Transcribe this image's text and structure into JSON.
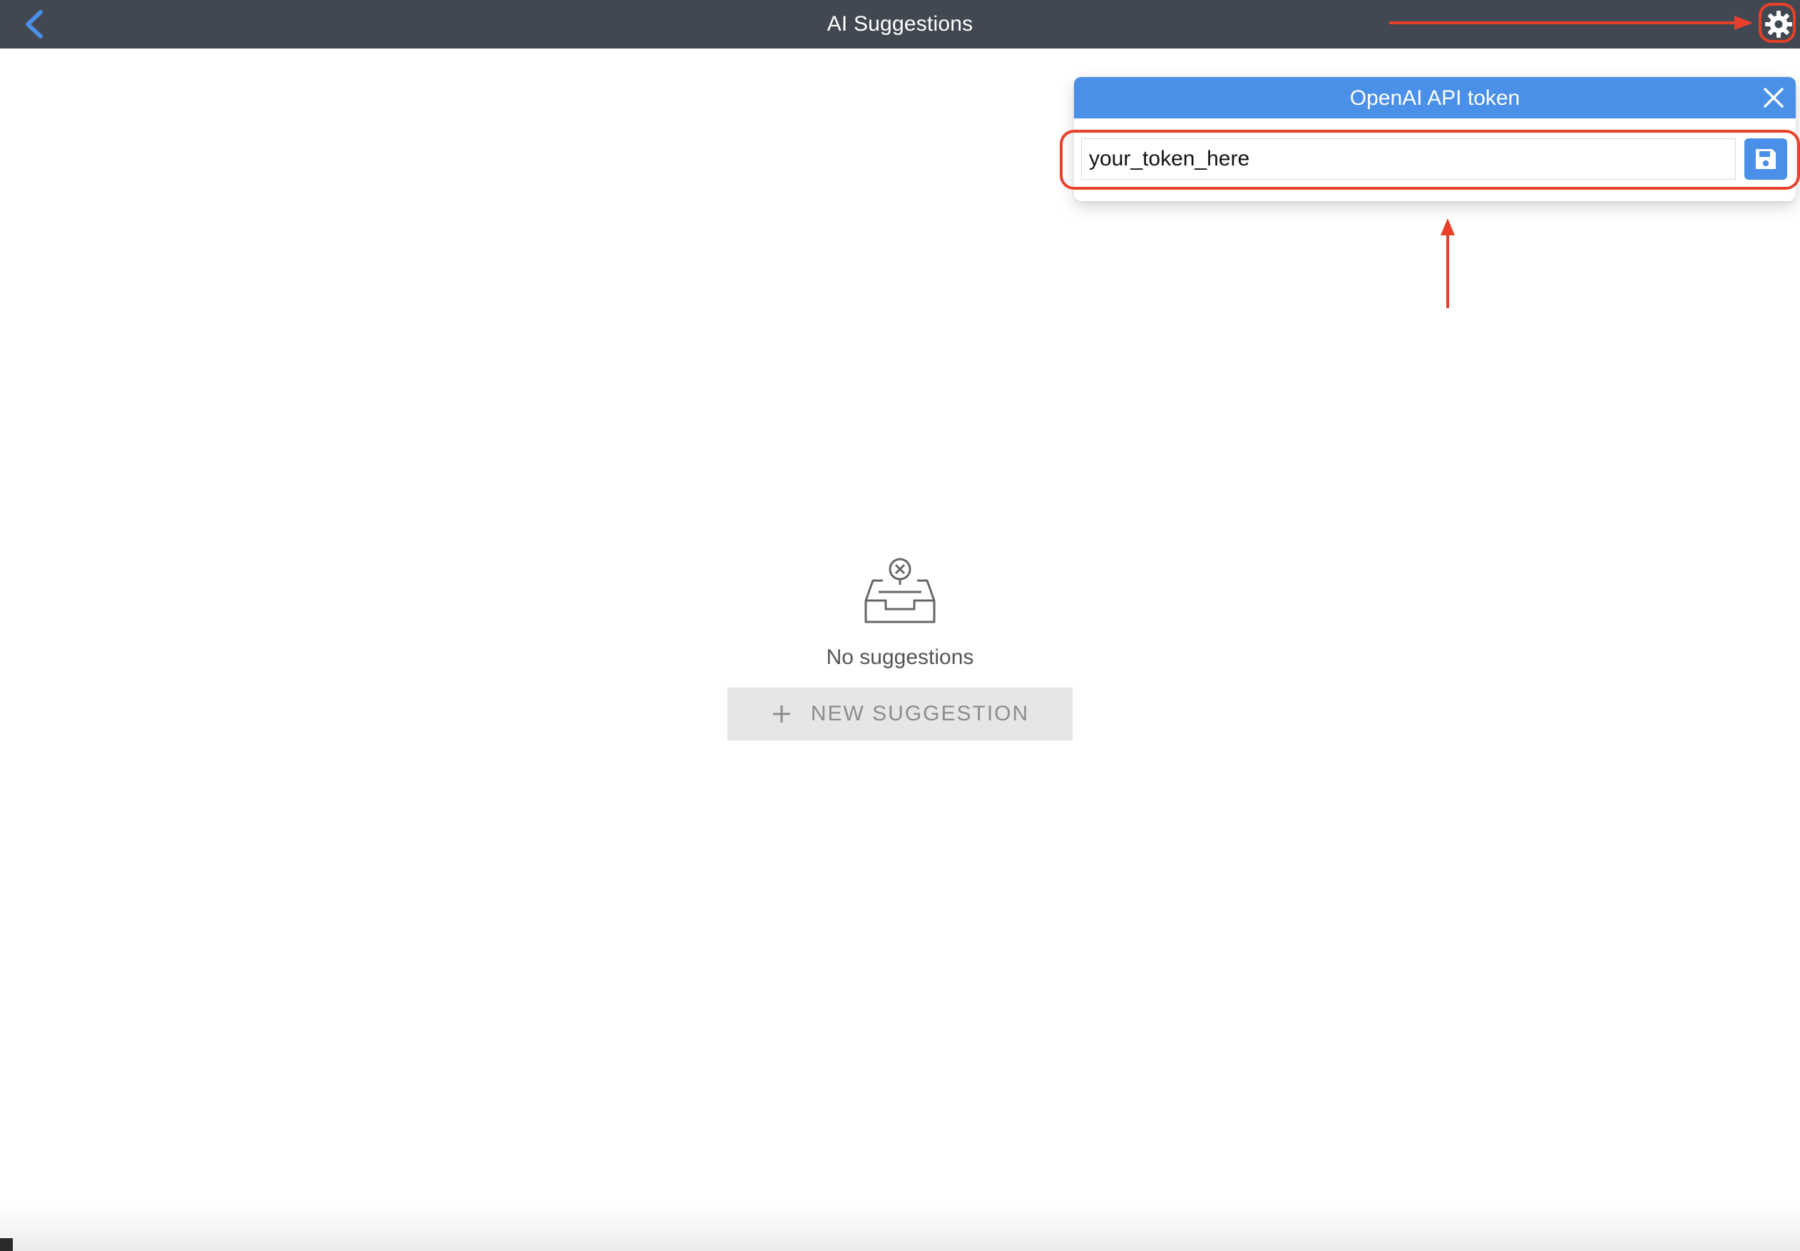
{
  "header": {
    "title": "AI Suggestions",
    "back_icon": "chevron-left-icon",
    "settings_icon": "gear-icon",
    "background_color": "#414852",
    "accent_color": "#4a90e8"
  },
  "token_popover": {
    "title": "OpenAI API token",
    "close_icon": "close-icon",
    "token_value": "your_token_here",
    "save_icon": "floppy-disk-icon"
  },
  "empty_state": {
    "icon": "empty-inbox-icon",
    "message": "No suggestions",
    "new_button_label": "NEW SUGGESTION",
    "new_button_icon": "plus-icon"
  },
  "annotations": {
    "highlight_color": "#e8402b"
  }
}
